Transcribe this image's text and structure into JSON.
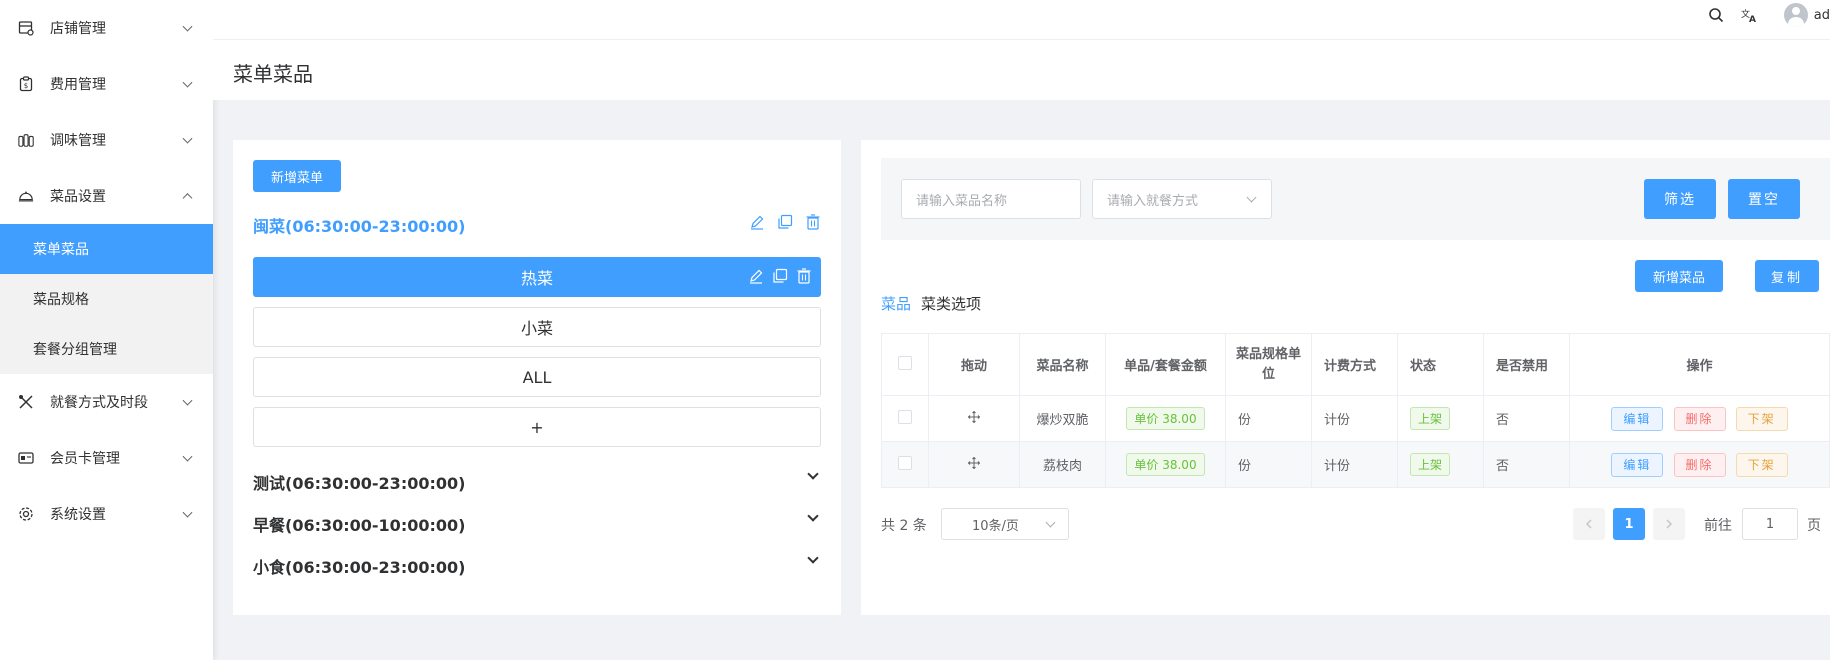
{
  "sidebar": {
    "items": [
      {
        "label": "店铺管理",
        "icon": "store-icon"
      },
      {
        "label": "费用管理",
        "icon": "fee-icon"
      },
      {
        "label": "调味管理",
        "icon": "seasoning-icon"
      },
      {
        "label": "菜品设置",
        "icon": "dish-icon"
      },
      {
        "label": "就餐方式及时段",
        "icon": "dining-icon"
      },
      {
        "label": "会员卡管理",
        "icon": "card-icon"
      },
      {
        "label": "系统设置",
        "icon": "settings-icon"
      }
    ],
    "submenu": [
      "菜单菜品",
      "菜品规格",
      "套餐分组管理"
    ],
    "active_sub": "菜单菜品"
  },
  "topbar": {
    "user": "ad"
  },
  "page": {
    "title": "菜单菜品"
  },
  "left": {
    "add_menu_label": "新增菜单",
    "open_group": "闽菜(06:30:00-23:00:00)",
    "categories": [
      "热菜",
      "小菜",
      "ALL",
      "+"
    ],
    "groups": [
      "测试(06:30:00-23:00:00)",
      "早餐(06:30:00-10:00:00)",
      "小食(06:30:00-23:00:00)"
    ]
  },
  "filter": {
    "name_placeholder": "请输入菜品名称",
    "dining_placeholder": "请输入就餐方式",
    "filter_label": "筛选",
    "clear_label": "置空"
  },
  "actions": {
    "add_dish": "新增菜品",
    "copy": "复制"
  },
  "tabs": [
    "菜品",
    "菜类选项"
  ],
  "table": {
    "headers": [
      "拖动",
      "菜品名称",
      "单品/套餐金额",
      "菜品规格单位",
      "计费方式",
      "状态",
      "是否禁用",
      "操作"
    ],
    "rows": [
      {
        "name": "爆炒双脆",
        "price": "单价 38.00",
        "unit": "份",
        "billing": "计份",
        "status": "上架",
        "disabled": "否"
      },
      {
        "name": "荔枝肉",
        "price": "单价 38.00",
        "unit": "份",
        "billing": "计份",
        "status": "上架",
        "disabled": "否"
      }
    ],
    "ops": {
      "edit": "编辑",
      "delete": "删除",
      "off": "下架"
    }
  },
  "pager": {
    "total": "共 2 条",
    "page_size": "10条/页",
    "current": "1",
    "goto_prefix": "前往",
    "goto_value": "1",
    "goto_suffix": "页"
  },
  "colors": {
    "primary": "#409eff",
    "success": "#67c23a",
    "danger": "#f56c6c",
    "warning": "#e6a23c"
  }
}
